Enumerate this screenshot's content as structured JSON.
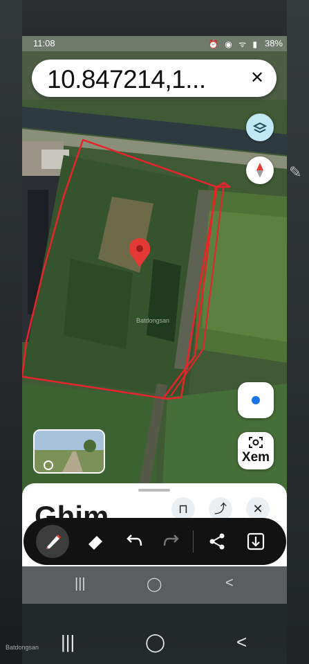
{
  "status_bar": {
    "time": "11:08",
    "icons": "⏰ ◉ ᯤ ▮",
    "battery": "38%"
  },
  "search_bar": {
    "text": "10.847214,1...",
    "close_label": "✕"
  },
  "map": {
    "watermark": "Batdongsan"
  },
  "bottom_sheet": {
    "title": "Ghim",
    "save_label": "⊓",
    "share_label": "⤴",
    "close_label": "✕"
  },
  "location_button": {
    "label": "Xem"
  },
  "markup_toolbar": {
    "pen": "✎",
    "eraser": "◇",
    "undo": "↶",
    "redo": "↷",
    "share": "⤴",
    "download": "⤓"
  },
  "nav": {
    "recents": "|||",
    "home": "◯",
    "back": "<"
  },
  "footer_watermark": "Batdongsan",
  "colors": {
    "annotation": "#e8232a",
    "pin": "#e53935",
    "accent": "#1a73e8"
  }
}
